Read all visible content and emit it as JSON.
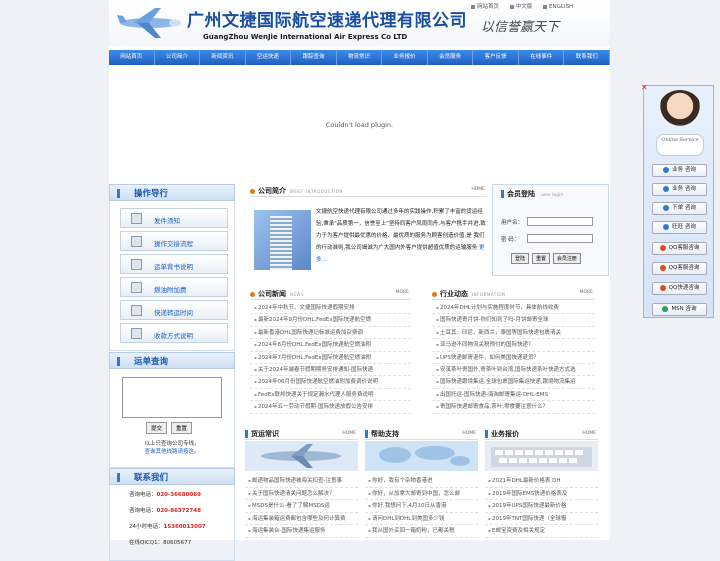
{
  "header": {
    "title_cn": "广州文捷国际航空速递代理有限公司",
    "title_en": "GuangZhou WenJie International Air Express Co LTD",
    "slogan": "以信誉赢天下",
    "links": [
      "网站首页",
      "中文版",
      "ENGLISH"
    ]
  },
  "nav": [
    "网站首页",
    "公司简介",
    "新闻资讯",
    "空运快递",
    "跟踪查询",
    "物流常识",
    "业务报价",
    "会员服务",
    "客户反馈",
    "在线事件",
    "联系我们"
  ],
  "plugin_message": "Couldn't load plugin.",
  "guide": {
    "title": "操作导行",
    "items": [
      "发件须知",
      "操作交接流程",
      "运单背书说明",
      "燃油附加费",
      "快递转运时间",
      "收款方式说明"
    ]
  },
  "tracking": {
    "title": "运单查询",
    "submit": "提交",
    "reset": "重置",
    "note1": "以上只查询公司专线，",
    "note2": "查询其他线路请按这。"
  },
  "contact": {
    "title": "联系我们",
    "phone1_label": "咨询电话：",
    "phone1": "020-36680069",
    "phone2_label": "咨询电话：",
    "phone2": "020-86372748",
    "hotline_label": "24小时电话：",
    "hotline": "15360013007",
    "qq_label": "在线QICQ1：",
    "qq": "80605677"
  },
  "intro": {
    "title": "公司简介",
    "en": "BRIEF INTRODUCTION",
    "more": "HOME",
    "text": "文捷航空快递代理有限公司通过多年的实践操作,积累了丰富的货运经验,秉承\"品质第一，信誉至上\"坚持同客户风雨同舟,与客户携手并进,致力于为客户提供最优惠的价格、最优质的服务为顾客创造价值,是 我们的行动准则,我公司竭诚为广大国内外客户提供超值优质的运输服务",
    "more_link": "更多..."
  },
  "login": {
    "title": "会员登陆",
    "en": "user login",
    "user_label": "用户名：",
    "pass_label": "密  码：",
    "buttons": [
      "登陆",
      "重置",
      "会员注册"
    ]
  },
  "news": {
    "title": "公司新闻",
    "en": "NEWS",
    "more": "MORE",
    "items": [
      "2024年中秋节、文捷国际快递假期安排",
      "最新2024年9月份DHL,FedEx国际快递航空燃",
      "最新香港DHL国际快递记标准运费加杂费调",
      "2024年8月份DHL,FedEx国际快递航空燃油附",
      "2024年7月份DHL,FedEx国际快递航空燃油附",
      "关于2024年端春节假期期务安排通知-国际快递",
      "2024年06月份国际快递航空燃油附加费调价说明",
      "FedEx联邦快递关于规定漏水代理人服务费说明",
      "2024年五一劳动节假期-国际快递放假公告安排"
    ]
  },
  "industry": {
    "title": "行业动态",
    "en": "INFORMATION",
    "more": "MORE",
    "items": [
      "2024年DHL计划与实施程度时节，具体航线收费",
      "国际快递寄月饼-你们知到了吗-月饼邮寄全球",
      "土耳其，印尼，新西兰，泰国等国际快递包裹清关",
      "亚马逊不同物流关税预付的国际快递？",
      "UPS快递邮寄退件，如何美国快递退货？",
      "安溪茶叶寄国外,寄茶叶到台湾,国际快递茶叶快递方式选",
      "国际快递跟境集运,全球包裹国际集运快递,跟境物流集运",
      "出国托运-国际快递-海淘邮寄集运-DHL-EMS",
      "寄国际快递邮寄食品,茶叶,零食要注意什么？"
    ]
  },
  "knowledge": {
    "title": "货运常识",
    "more": "HOME",
    "items": [
      "邮递物品国际快递被海关扣查-注意事",
      "关于国际快递清关问题怎么解决？",
      "MSDS是什么-看了了解MSDS运",
      "海运集装箱运费都包含哪些及何计算费",
      "海运集装合-国际快递集运服务"
    ]
  },
  "help": {
    "title": "帮助支持",
    "more": "HOME",
    "items": [
      "你好，我有个杂物香港进",
      "你好，从加拿大邮寄到中国，怎么邮",
      "你好,我想问下,4月10日从香港",
      "请问DHL到DHL到美国多少钱",
      "我从国外买回一箱奶粉，已都关税"
    ]
  },
  "quote": {
    "title": "业务报价",
    "more": "HOME",
    "items": [
      "2021年DHL最新价格表 DH",
      "2019年国际EMS快递价格表及",
      "2019年UPS国际快递最新价格",
      "2019年TNT国际快递（全球报",
      "E邮宝资费及相关规定"
    ]
  },
  "float_panel": {
    "service": "Online Service",
    "buttons": [
      "业务 咨询",
      "业务 咨询",
      "下单 咨询",
      "旺旺 咨询",
      "QQ客服咨询",
      "QQ客服咨询",
      "QQ快递咨询",
      "MSN 咨询"
    ]
  }
}
